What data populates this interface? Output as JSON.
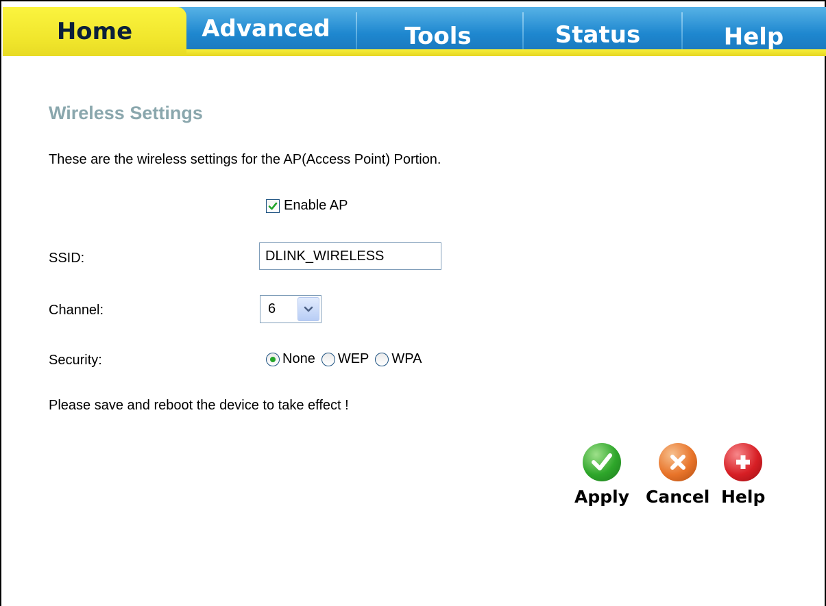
{
  "tabs": [
    {
      "label": "Home",
      "active": true
    },
    {
      "label": "Advanced",
      "active": false
    },
    {
      "label": "Tools",
      "active": false
    },
    {
      "label": "Status",
      "active": false
    },
    {
      "label": "Help",
      "active": false
    }
  ],
  "page": {
    "title": "Wireless Settings",
    "intro": "These are the wireless settings for the AP(Access Point) Portion.",
    "notice": "Please save and reboot the device to take effect !"
  },
  "form": {
    "enable_ap": {
      "label": "Enable AP",
      "checked": true
    },
    "ssid": {
      "label": "SSID:",
      "value": "DLINK_WIRELESS"
    },
    "channel": {
      "label": "Channel:",
      "value": "6"
    },
    "security": {
      "label": "Security:",
      "options": [
        "None",
        "WEP",
        "WPA"
      ],
      "selected": "None"
    }
  },
  "actions": {
    "apply": "Apply",
    "cancel": "Cancel",
    "help": "Help"
  },
  "colors": {
    "tab_blue": "#1e87cf",
    "tab_yellow": "#f0e52b",
    "title_color": "#8aa7ad",
    "apply_green": "#2ea62a",
    "cancel_orange": "#e8742a",
    "help_red": "#d71f25"
  }
}
